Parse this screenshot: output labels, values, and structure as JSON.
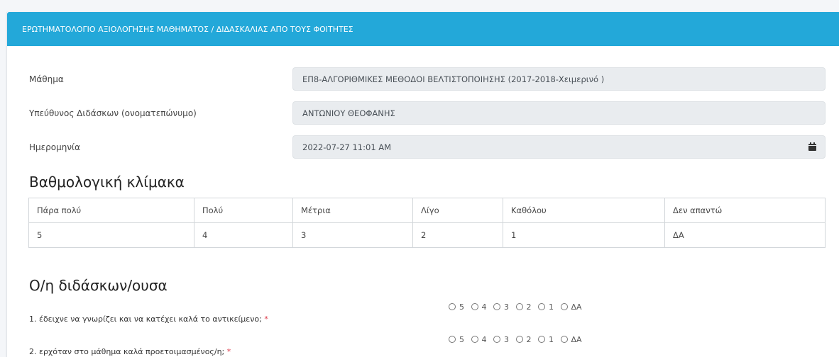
{
  "header": {
    "title": "ΕΡΩΤΗΜΑΤΟΛΟΓΙΟ ΑΞΙΟΛΟΓΗΣΗΣ ΜΑΘΗΜΑΤΟΣ / ΔΙΔΑΣΚΑΛΙΑΣ ΑΠΟ ΤΟΥΣ ΦΟΙΤΗΤΕΣ"
  },
  "fields": {
    "course": {
      "label": "Μάθημα",
      "value": "ΕΠ8-ΑΛΓΟΡΙΘΜΙΚΕΣ ΜΕΘΟΔΟΙ ΒΕΛΤΙΣΤΟΠΟΙΗΣΗΣ (2017-2018-Χειμερινό )"
    },
    "instructor": {
      "label": "Υπεύθυνος Διδάσκων (ονοματεπώνυμο)",
      "value": "ΑΝΤΩΝΙΟΥ ΘΕΟΦΑΝΗΣ"
    },
    "date": {
      "label": "Ημερομηνία",
      "value": "2022-07-27 11:01 AM"
    }
  },
  "scale": {
    "heading": "Βαθμολογική κλίμακα",
    "labels": [
      "Πάρα πολύ",
      "Πολύ",
      "Μέτρια",
      "Λίγο",
      "Καθόλου",
      "Δεν απαντώ"
    ],
    "values": [
      "5",
      "4",
      "3",
      "2",
      "1",
      "ΔΑ"
    ]
  },
  "section": {
    "heading": "Ο/η διδάσκων/ουσα"
  },
  "questions": [
    {
      "text": "1. έδειχνε να γνωρίζει και να κατέχει καλά το αντικείμενο;",
      "required": "*"
    },
    {
      "text": "2. ερχόταν στο μάθημα καλά προετοιμασμένος/η;",
      "required": "*"
    }
  ],
  "radio_options": [
    "5",
    "4",
    "3",
    "2",
    "1",
    "ΔΑ"
  ],
  "colors": {
    "header_bg": "#23a8d9",
    "required": "#dc3545"
  },
  "icons": {
    "date_button": "calendar-icon"
  }
}
